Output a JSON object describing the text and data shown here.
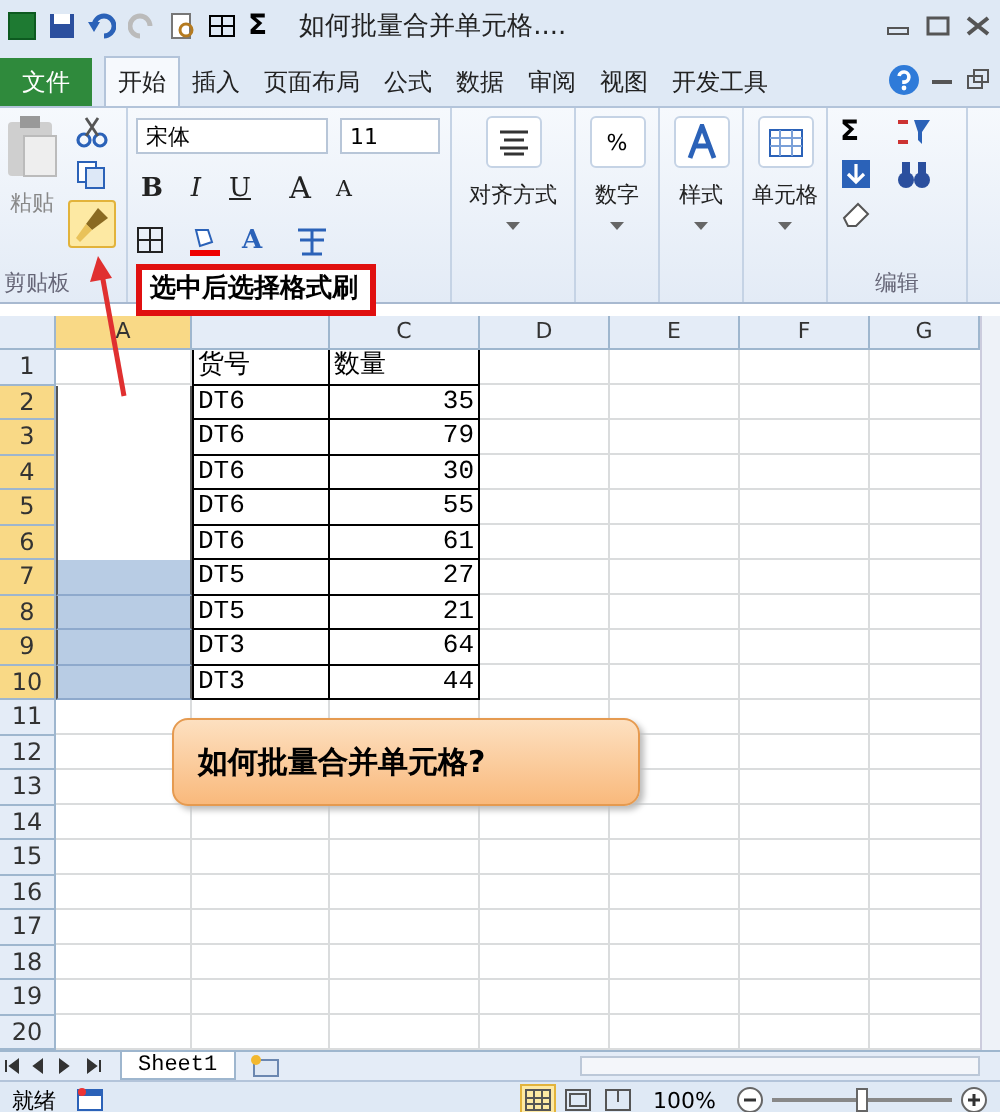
{
  "window": {
    "title": "如何批量合并单元格....",
    "quick_sum_glyph": "Σ"
  },
  "tabs": [
    {
      "label": "文件",
      "kind": "file",
      "selected": false
    },
    {
      "label": "开始",
      "kind": "tab",
      "selected": true
    },
    {
      "label": "插入",
      "kind": "tab",
      "selected": false
    },
    {
      "label": "页面布局",
      "kind": "tab",
      "selected": false
    },
    {
      "label": "公式",
      "kind": "tab",
      "selected": false
    },
    {
      "label": "数据",
      "kind": "tab",
      "selected": false
    },
    {
      "label": "审阅",
      "kind": "tab",
      "selected": false
    },
    {
      "label": "视图",
      "kind": "tab",
      "selected": false
    },
    {
      "label": "开发工具",
      "kind": "tab",
      "selected": false
    }
  ],
  "ribbon": {
    "paste_label": "粘贴",
    "clipboard_label": "剪贴板",
    "format_painter_selected": true,
    "font_name": "宋体",
    "font_size": "11",
    "font_buttons": [
      "B",
      "I",
      "U"
    ],
    "grow_font": "A",
    "shrink_font": "A",
    "font_color": "A",
    "big_buttons": [
      {
        "label": "对齐方式",
        "kind": "align"
      },
      {
        "label": "数字",
        "kind": "number",
        "glyph": "%"
      },
      {
        "label": "样式",
        "kind": "style"
      },
      {
        "label": "单元格",
        "kind": "cells"
      }
    ],
    "sum_glyph": "Σ",
    "editing_label": "编辑"
  },
  "sheet": {
    "columns": [
      {
        "header": "A",
        "selected": true
      },
      {
        "selected": false
      },
      {
        "header": "C",
        "selected": false
      },
      {
        "header": "D",
        "selected": false
      },
      {
        "header": "E",
        "selected": false
      },
      {
        "header": "F",
        "selected": false
      },
      {
        "header": "G",
        "selected": false
      }
    ],
    "rows": [
      {
        "number": "1",
        "selected": false,
        "b": "货号",
        "c": "数量"
      },
      {
        "number": "2",
        "selected": true,
        "a_filled": false,
        "b": "DT6",
        "c": "35"
      },
      {
        "number": "3",
        "selected": true,
        "a_filled": false,
        "b": "DT6",
        "c": "79"
      },
      {
        "number": "4",
        "selected": true,
        "a_filled": false,
        "b": "DT6",
        "c": "30"
      },
      {
        "number": "5",
        "selected": true,
        "a_filled": false,
        "b": "DT6",
        "c": "55"
      },
      {
        "number": "6",
        "selected": true,
        "a_filled": false,
        "b": "DT6",
        "c": "61"
      },
      {
        "number": "7",
        "selected": true,
        "a_filled": true,
        "b": "DT5",
        "c": "27"
      },
      {
        "number": "8",
        "selected": true,
        "a_filled": true,
        "b": "DT5",
        "c": "21"
      },
      {
        "number": "9",
        "selected": true,
        "a_filled": true,
        "b": "DT3",
        "c": "64"
      },
      {
        "number": "10",
        "selected": true,
        "a_filled": true,
        "b": "DT3",
        "c": "44"
      },
      {
        "number": "11",
        "selected": false
      },
      {
        "number": "12",
        "selected": false
      },
      {
        "number": "13",
        "selected": false
      },
      {
        "number": "14",
        "selected": false
      },
      {
        "number": "15",
        "selected": false
      },
      {
        "number": "16",
        "selected": false
      },
      {
        "number": "17",
        "selected": false
      },
      {
        "number": "18",
        "selected": false
      },
      {
        "number": "19",
        "selected": false
      },
      {
        "number": "20",
        "selected": false
      }
    ],
    "note_callout": {
      "text": "选中后选择格式刷"
    },
    "title_shape": {
      "text": "如何批量合并单元格?"
    },
    "sheet_tabs": [
      {
        "label": "Sheet1",
        "selected": true
      }
    ]
  },
  "status_bar": {
    "state": "就绪",
    "zoom": "100%",
    "zoom_slider": {
      "level": 0.5
    }
  }
}
